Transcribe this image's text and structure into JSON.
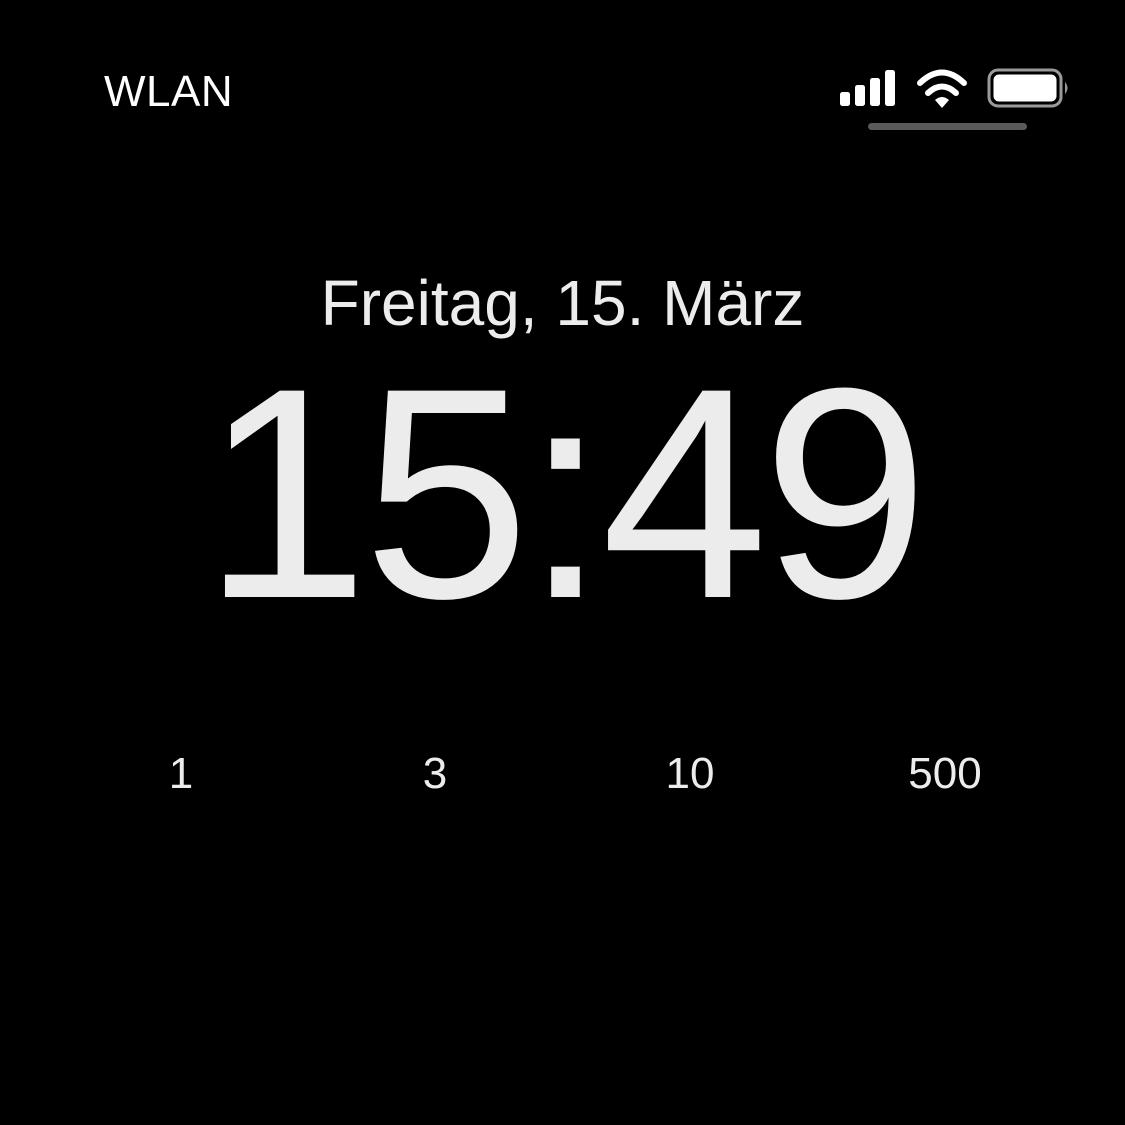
{
  "status_bar": {
    "carrier": "WLAN",
    "signal_icon": "cellular-signal-icon",
    "wifi_icon": "wifi-icon",
    "battery_icon": "battery-icon",
    "battery_level": 1.0
  },
  "lock_screen": {
    "date": "Freitag, 15. März",
    "time": "15:49"
  },
  "widgets": [
    {
      "value": "1"
    },
    {
      "value": "3"
    },
    {
      "value": "10"
    },
    {
      "value": "500"
    }
  ],
  "colors": {
    "background": "#000000",
    "text": "#ececec",
    "indicator": "#5a5a5a"
  }
}
